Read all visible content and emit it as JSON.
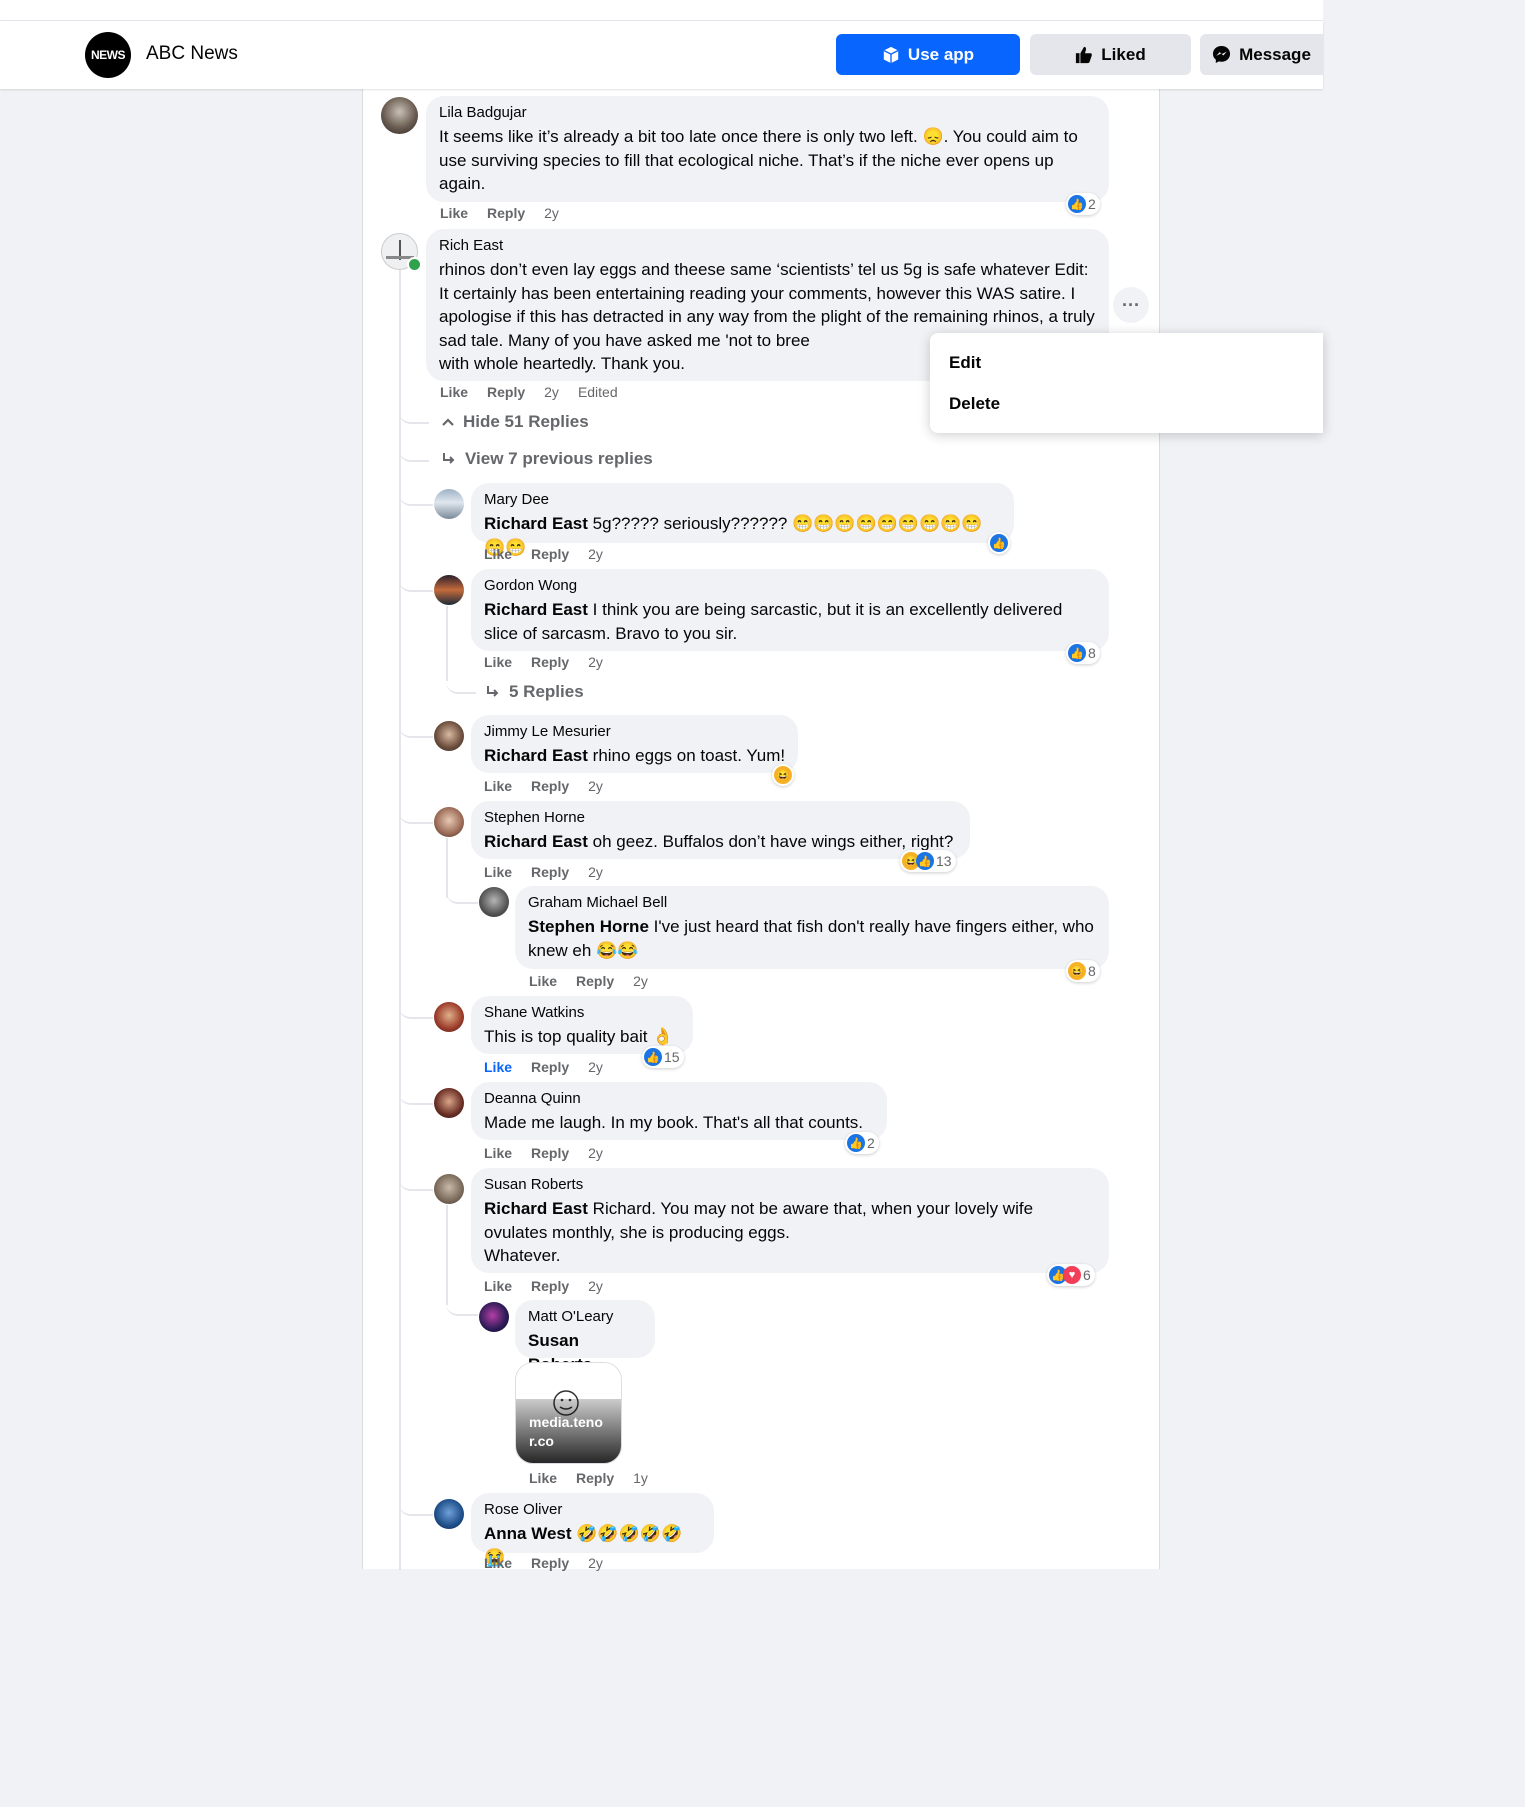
{
  "header": {
    "page_name": "ABC News",
    "logo_text": "NEWS",
    "buttons": {
      "use_app": "Use app",
      "liked": "Liked",
      "message": "Message"
    }
  },
  "labels": {
    "like": "Like",
    "reply": "Reply",
    "edited": "Edited"
  },
  "menu": {
    "edit": "Edit",
    "delete": "Delete"
  },
  "comments": {
    "lila": {
      "name": "Lila Badgujar",
      "text": "It seems like it’s already a bit too late once there is only two left. 😞. You could aim to use surviving species to fill that ecological niche. That’s if the niche ever opens up again.",
      "time": "2y",
      "reactions": "2"
    },
    "rich": {
      "name": "Rich East",
      "text": "rhinos don’t even lay eggs and theese same ‘scientists’ tel us 5g is safe whatever Edit: It certainly has been entertaining reading your comments, however this WAS satire. I apologise if this has detracted in any way from the plight of the remaining rhinos, a truly sad tale. Many of you have asked me 'not to bree",
      "text_tail": "with whole heartedly. Thank you.",
      "time": "2y"
    },
    "hide_replies": "Hide 51 Replies",
    "view_previous": "View 7 previous replies",
    "mary": {
      "name": "Mary Dee",
      "mention": "Richard East",
      "text": " 5g????? seriously?????? 😁😁😁😁😁😁😁😁😁😁😁",
      "time": "2y"
    },
    "gordon": {
      "name": "Gordon Wong",
      "mention": "Richard East",
      "text": " I think you are being sarcastic, but it is an excellently delivered slice of sarcasm. Bravo to you sir.",
      "time": "2y",
      "reactions": "8"
    },
    "gordon_replies": "5 Replies",
    "jimmy": {
      "name": "Jimmy Le Mesurier",
      "mention": "Richard East",
      "text": " rhino eggs on toast. Yum!",
      "time": "2y"
    },
    "stephen": {
      "name": "Stephen Horne",
      "mention": "Richard East",
      "text": " oh geez. Buffalos don’t have wings either, right?",
      "time": "2y",
      "reactions": "13"
    },
    "graham": {
      "name": "Graham Michael Bell",
      "mention": "Stephen Horne",
      "text": " I've just heard that fish don't really have fingers either, who knew eh 😂😂",
      "time": "2y",
      "reactions": "8"
    },
    "shane": {
      "name": "Shane Watkins",
      "text": "This is top quality bait 👌",
      "time": "2y",
      "reactions": "15"
    },
    "deanna": {
      "name": "Deanna Quinn",
      "text": "Made me laugh. In my book. That's all that counts.",
      "time": "2y",
      "reactions": "2"
    },
    "susan": {
      "name": "Susan Roberts",
      "mention": "Richard East",
      "text": " Richard. You may not be aware that, when your lovely wife ovulates monthly, she is producing eggs.",
      "text2": "Whatever.",
      "time": "2y",
      "reactions": "6"
    },
    "matt": {
      "name": "Matt O'Leary",
      "mention": "Susan Roberts",
      "gif_caption": "media.tenor.co",
      "time": "1y"
    },
    "rose": {
      "name": "Rose Oliver",
      "mention": "Anna West",
      "text": " 🤣🤣🤣🤣🤣😭",
      "time": "2y"
    }
  },
  "colors": {
    "accent": "#0866ff",
    "bubble": "#f0f2f5",
    "meta": "#65676b"
  }
}
